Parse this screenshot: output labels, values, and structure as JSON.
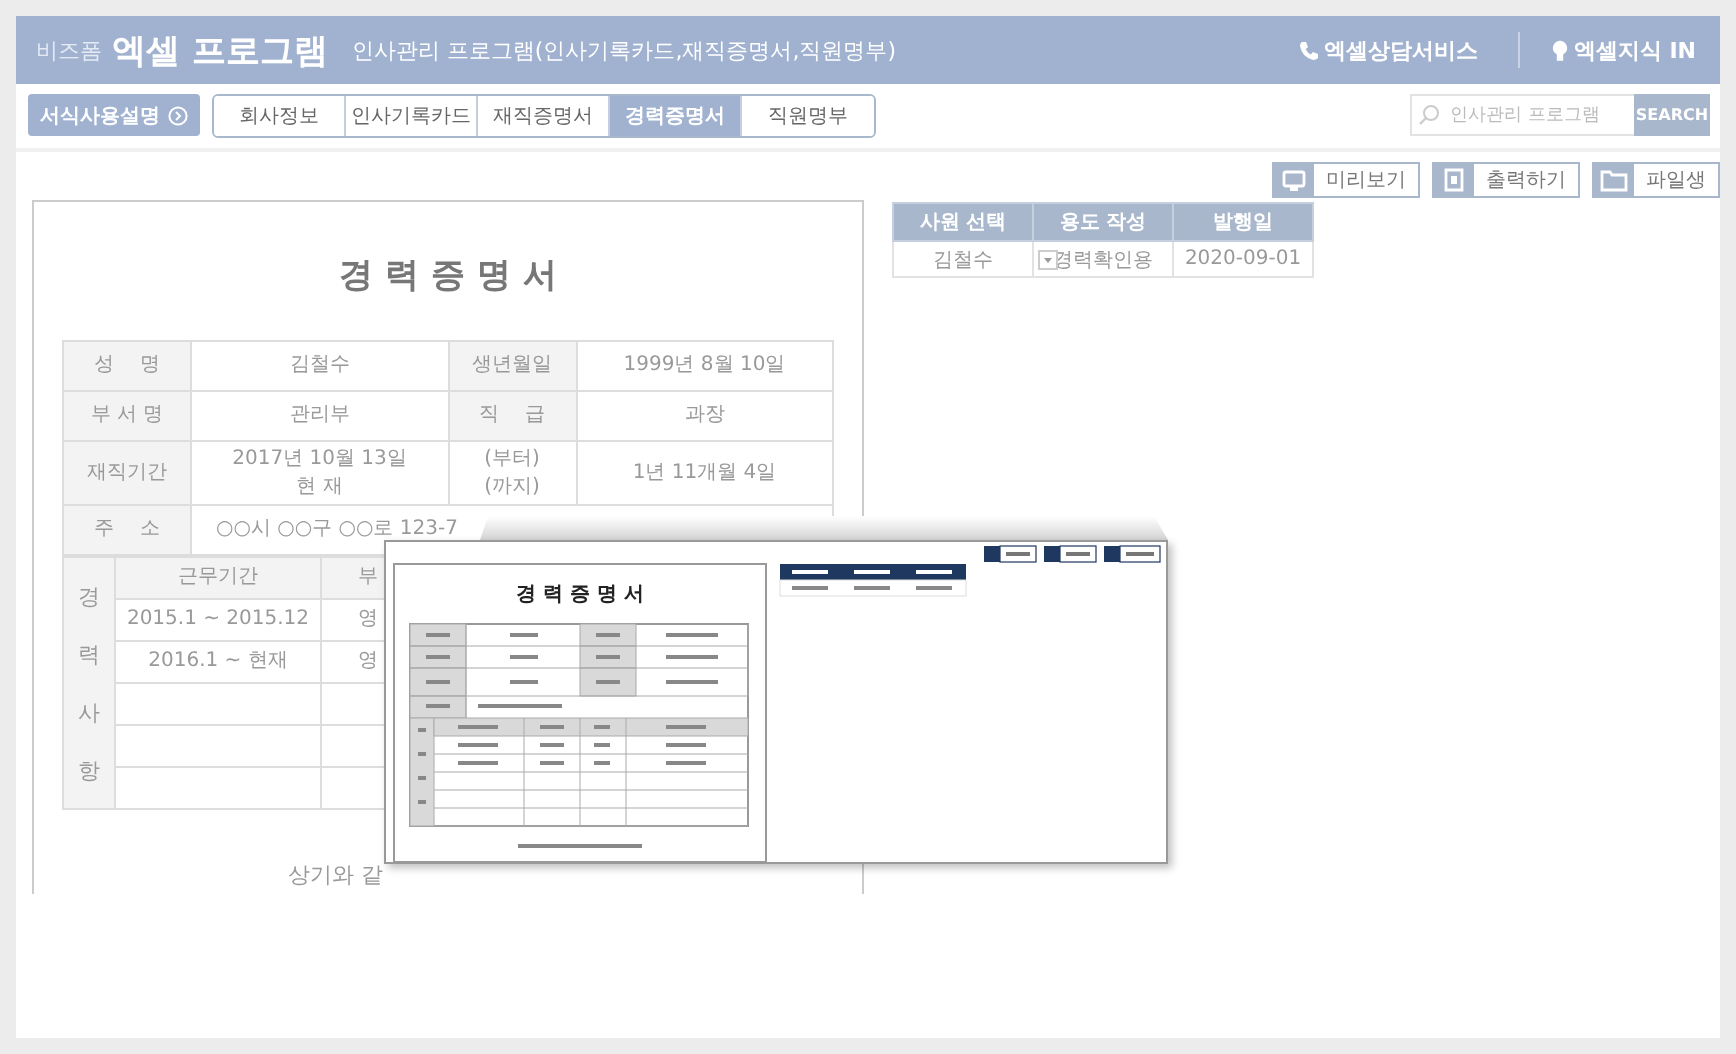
{
  "header": {
    "brand": "비즈폼",
    "title": "엑셀 프로그램",
    "subtitle": "인사관리 프로그램(인사기록카드,재직증명서,직원명부)",
    "links": [
      {
        "kind": "phone",
        "label": "엑셀상담서비스"
      },
      {
        "kind": "bulb",
        "label": "엑셀지식 IN"
      }
    ]
  },
  "nav": {
    "guide_button": "서식사용설명",
    "tabs": [
      {
        "label": "회사정보",
        "selected": false
      },
      {
        "label": "인사기록카드",
        "selected": false
      },
      {
        "label": "재직증명서",
        "selected": false
      },
      {
        "label": "경력증명서",
        "selected": true
      },
      {
        "label": "직원명부",
        "selected": false
      }
    ],
    "search": {
      "placeholder": "인사관리 프로그램",
      "button": "SEARCH"
    }
  },
  "workspace": {
    "actions": [
      {
        "kind": "preview",
        "label": "미리보기"
      },
      {
        "kind": "print",
        "label": "출력하기"
      },
      {
        "kind": "file",
        "label": "파일생"
      }
    ],
    "document": {
      "title": "경 력 증 명 서",
      "person": [
        {
          "label": "성    명",
          "value": "김철수"
        },
        {
          "label": "생년월일",
          "value": "1999년 8월 10일"
        },
        {
          "label": "부 서 명",
          "value": "관리부"
        },
        {
          "label": "직    급",
          "value": "과장"
        }
      ],
      "tenure": {
        "label": "재직기간",
        "from": "2017년 10월 13일",
        "to": "현 재",
        "from_note": "(부터)",
        "to_note": "(까지)",
        "length": "1년 11개월 4일"
      },
      "address": {
        "label": "주    소",
        "value": "○○시 ○○구 ○○로 123-7"
      },
      "career": {
        "label": "경력사항",
        "columns": [
          "근무기간",
          "부"
        ],
        "rows": [
          [
            "2015.1 ~ 2015.12",
            "영"
          ],
          [
            "2016.1 ~ 현재",
            "영"
          ]
        ]
      },
      "footer": "상기와 같"
    },
    "employee_table": {
      "columns": [
        "사원 선택",
        "용도 작성",
        "발행일"
      ],
      "rows": [
        {
          "employee": "김철수",
          "purpose": "경력확인용",
          "issued": "2020-09-01"
        }
      ]
    }
  },
  "preview_popup": {
    "title": "경 력 증 명 서"
  }
}
